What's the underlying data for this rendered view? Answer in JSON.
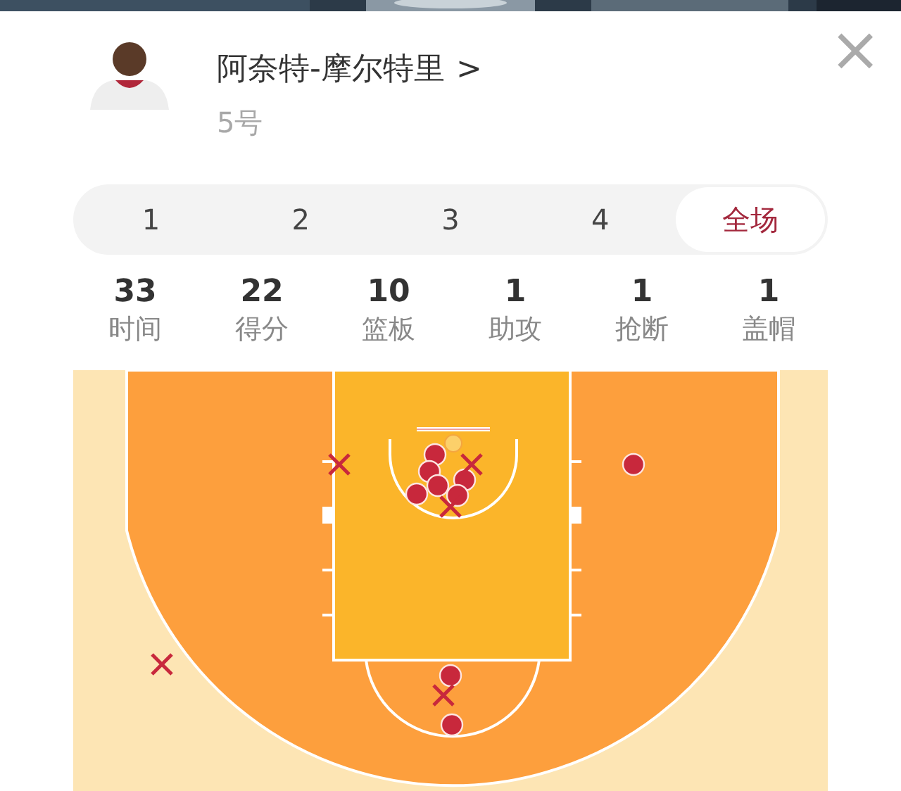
{
  "player": {
    "name": "阿奈特-摩尔特里",
    "chevron": ">",
    "number": "5号"
  },
  "close": "×",
  "periods": [
    {
      "label": "1",
      "selected": false
    },
    {
      "label": "2",
      "selected": false
    },
    {
      "label": "3",
      "selected": false
    },
    {
      "label": "4",
      "selected": false
    },
    {
      "label": "全场",
      "selected": true
    }
  ],
  "stats": [
    {
      "value": "33",
      "label": "时间"
    },
    {
      "value": "22",
      "label": "得分"
    },
    {
      "value": "10",
      "label": "篮板"
    },
    {
      "value": "1",
      "label": "助攻"
    },
    {
      "value": "1",
      "label": "抢断"
    },
    {
      "value": "1",
      "label": "盖帽"
    }
  ],
  "shots": [
    {
      "made": true
    },
    {
      "made": true
    },
    {
      "made": true
    },
    {
      "made": true
    },
    {
      "made": true
    },
    {
      "made": true
    },
    {
      "made": true
    },
    {
      "made": true
    },
    {
      "made": true
    },
    {
      "made": false
    },
    {
      "made": false
    },
    {
      "made": false
    },
    {
      "made": false
    },
    {
      "made": false
    }
  ]
}
